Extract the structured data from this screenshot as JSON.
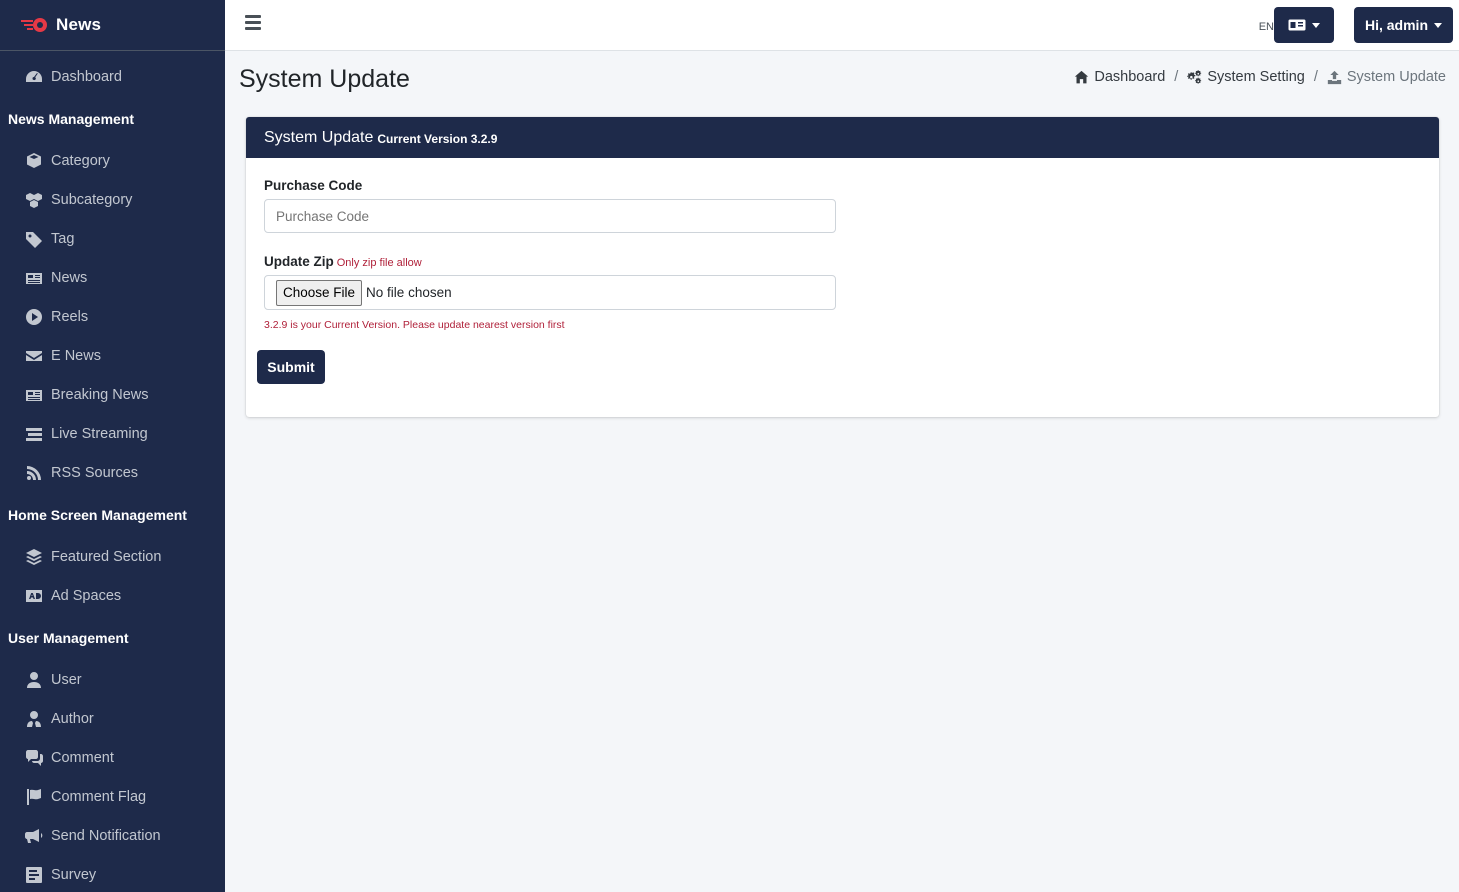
{
  "brand": {
    "name": "News"
  },
  "sidebar": {
    "items": [
      {
        "type": "item",
        "label": "Dashboard",
        "icon": "dashboard-icon"
      },
      {
        "type": "header",
        "label": "News Management"
      },
      {
        "type": "item",
        "label": "Category",
        "icon": "cube-icon"
      },
      {
        "type": "item",
        "label": "Subcategory",
        "icon": "cubes-icon"
      },
      {
        "type": "item",
        "label": "Tag",
        "icon": "tag-icon"
      },
      {
        "type": "item",
        "label": "News",
        "icon": "newspaper-icon"
      },
      {
        "type": "item",
        "label": "Reels",
        "icon": "play-circle-icon"
      },
      {
        "type": "item",
        "label": "E News",
        "icon": "envelope-icon"
      },
      {
        "type": "item",
        "label": "Breaking News",
        "icon": "newspaper-icon"
      },
      {
        "type": "item",
        "label": "Live Streaming",
        "icon": "stream-icon"
      },
      {
        "type": "item",
        "label": "RSS Sources",
        "icon": "rss-icon"
      },
      {
        "type": "header",
        "label": "Home Screen Management"
      },
      {
        "type": "item",
        "label": "Featured Section",
        "icon": "layers-icon"
      },
      {
        "type": "item",
        "label": "Ad Spaces",
        "icon": "ad-icon"
      },
      {
        "type": "header",
        "label": "User Management"
      },
      {
        "type": "item",
        "label": "User",
        "icon": "user-icon"
      },
      {
        "type": "item",
        "label": "Author",
        "icon": "user-tie-icon"
      },
      {
        "type": "item",
        "label": "Comment",
        "icon": "comments-icon"
      },
      {
        "type": "item",
        "label": "Comment Flag",
        "icon": "flag-icon"
      },
      {
        "type": "item",
        "label": "Send Notification",
        "icon": "bullhorn-icon"
      },
      {
        "type": "item",
        "label": "Survey",
        "icon": "poll-icon"
      }
    ]
  },
  "topbar": {
    "lang_code": "EN",
    "user_label": "Hi, admin"
  },
  "page": {
    "title": "System Update"
  },
  "breadcrumb": [
    {
      "label": "Dashboard",
      "icon": "home-icon"
    },
    {
      "label": "System Setting",
      "icon": "cogs-icon"
    },
    {
      "label": "System Update",
      "icon": "upload-icon"
    }
  ],
  "card": {
    "title": "System Update",
    "subtitle": "Current Version 3.2.9",
    "purchase_label": "Purchase Code",
    "purchase_placeholder": "Purchase Code",
    "zip_label": "Update Zip",
    "zip_hint": "Only zip file allow",
    "file_button": "Choose File",
    "file_status": "No file chosen",
    "version_note": "3.2.9 is your Current Version. Please update nearest version first",
    "submit_label": "Submit"
  },
  "colors": {
    "navy": "#1e2a4a",
    "error": "#b0213a"
  }
}
